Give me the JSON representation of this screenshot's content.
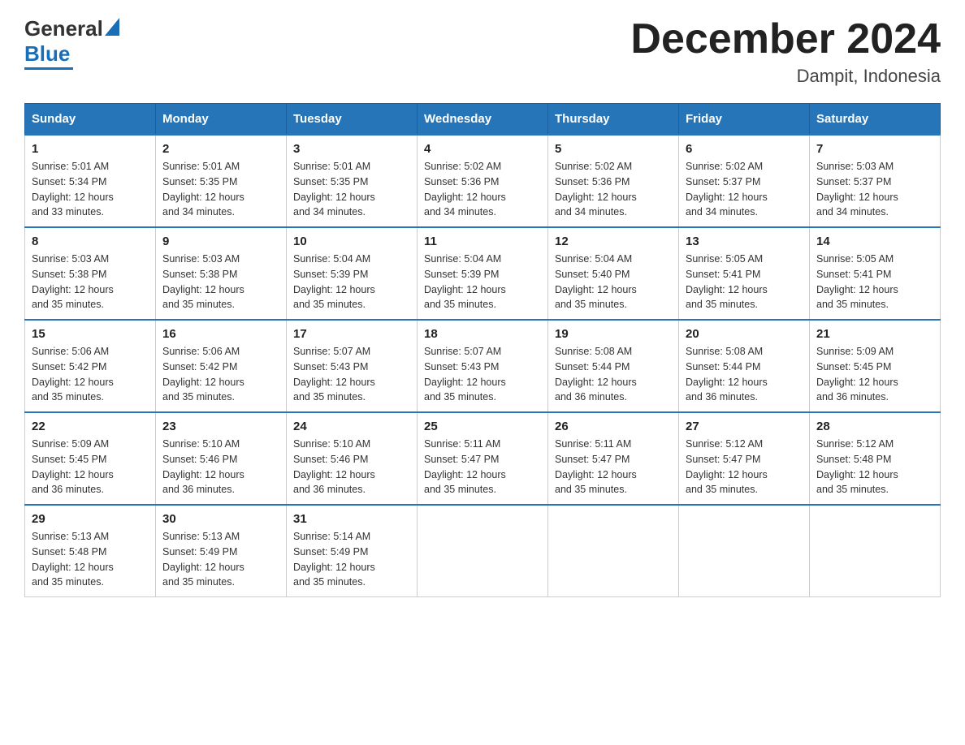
{
  "header": {
    "title": "December 2024",
    "subtitle": "Dampit, Indonesia",
    "logo_general": "General",
    "logo_blue": "Blue"
  },
  "days_of_week": [
    "Sunday",
    "Monday",
    "Tuesday",
    "Wednesday",
    "Thursday",
    "Friday",
    "Saturday"
  ],
  "weeks": [
    [
      {
        "day": "1",
        "sunrise": "5:01 AM",
        "sunset": "5:34 PM",
        "daylight": "12 hours and 33 minutes."
      },
      {
        "day": "2",
        "sunrise": "5:01 AM",
        "sunset": "5:35 PM",
        "daylight": "12 hours and 34 minutes."
      },
      {
        "day": "3",
        "sunrise": "5:01 AM",
        "sunset": "5:35 PM",
        "daylight": "12 hours and 34 minutes."
      },
      {
        "day": "4",
        "sunrise": "5:02 AM",
        "sunset": "5:36 PM",
        "daylight": "12 hours and 34 minutes."
      },
      {
        "day": "5",
        "sunrise": "5:02 AM",
        "sunset": "5:36 PM",
        "daylight": "12 hours and 34 minutes."
      },
      {
        "day": "6",
        "sunrise": "5:02 AM",
        "sunset": "5:37 PM",
        "daylight": "12 hours and 34 minutes."
      },
      {
        "day": "7",
        "sunrise": "5:03 AM",
        "sunset": "5:37 PM",
        "daylight": "12 hours and 34 minutes."
      }
    ],
    [
      {
        "day": "8",
        "sunrise": "5:03 AM",
        "sunset": "5:38 PM",
        "daylight": "12 hours and 35 minutes."
      },
      {
        "day": "9",
        "sunrise": "5:03 AM",
        "sunset": "5:38 PM",
        "daylight": "12 hours and 35 minutes."
      },
      {
        "day": "10",
        "sunrise": "5:04 AM",
        "sunset": "5:39 PM",
        "daylight": "12 hours and 35 minutes."
      },
      {
        "day": "11",
        "sunrise": "5:04 AM",
        "sunset": "5:39 PM",
        "daylight": "12 hours and 35 minutes."
      },
      {
        "day": "12",
        "sunrise": "5:04 AM",
        "sunset": "5:40 PM",
        "daylight": "12 hours and 35 minutes."
      },
      {
        "day": "13",
        "sunrise": "5:05 AM",
        "sunset": "5:41 PM",
        "daylight": "12 hours and 35 minutes."
      },
      {
        "day": "14",
        "sunrise": "5:05 AM",
        "sunset": "5:41 PM",
        "daylight": "12 hours and 35 minutes."
      }
    ],
    [
      {
        "day": "15",
        "sunrise": "5:06 AM",
        "sunset": "5:42 PM",
        "daylight": "12 hours and 35 minutes."
      },
      {
        "day": "16",
        "sunrise": "5:06 AM",
        "sunset": "5:42 PM",
        "daylight": "12 hours and 35 minutes."
      },
      {
        "day": "17",
        "sunrise": "5:07 AM",
        "sunset": "5:43 PM",
        "daylight": "12 hours and 35 minutes."
      },
      {
        "day": "18",
        "sunrise": "5:07 AM",
        "sunset": "5:43 PM",
        "daylight": "12 hours and 35 minutes."
      },
      {
        "day": "19",
        "sunrise": "5:08 AM",
        "sunset": "5:44 PM",
        "daylight": "12 hours and 36 minutes."
      },
      {
        "day": "20",
        "sunrise": "5:08 AM",
        "sunset": "5:44 PM",
        "daylight": "12 hours and 36 minutes."
      },
      {
        "day": "21",
        "sunrise": "5:09 AM",
        "sunset": "5:45 PM",
        "daylight": "12 hours and 36 minutes."
      }
    ],
    [
      {
        "day": "22",
        "sunrise": "5:09 AM",
        "sunset": "5:45 PM",
        "daylight": "12 hours and 36 minutes."
      },
      {
        "day": "23",
        "sunrise": "5:10 AM",
        "sunset": "5:46 PM",
        "daylight": "12 hours and 36 minutes."
      },
      {
        "day": "24",
        "sunrise": "5:10 AM",
        "sunset": "5:46 PM",
        "daylight": "12 hours and 36 minutes."
      },
      {
        "day": "25",
        "sunrise": "5:11 AM",
        "sunset": "5:47 PM",
        "daylight": "12 hours and 35 minutes."
      },
      {
        "day": "26",
        "sunrise": "5:11 AM",
        "sunset": "5:47 PM",
        "daylight": "12 hours and 35 minutes."
      },
      {
        "day": "27",
        "sunrise": "5:12 AM",
        "sunset": "5:47 PM",
        "daylight": "12 hours and 35 minutes."
      },
      {
        "day": "28",
        "sunrise": "5:12 AM",
        "sunset": "5:48 PM",
        "daylight": "12 hours and 35 minutes."
      }
    ],
    [
      {
        "day": "29",
        "sunrise": "5:13 AM",
        "sunset": "5:48 PM",
        "daylight": "12 hours and 35 minutes."
      },
      {
        "day": "30",
        "sunrise": "5:13 AM",
        "sunset": "5:49 PM",
        "daylight": "12 hours and 35 minutes."
      },
      {
        "day": "31",
        "sunrise": "5:14 AM",
        "sunset": "5:49 PM",
        "daylight": "12 hours and 35 minutes."
      },
      null,
      null,
      null,
      null
    ]
  ],
  "labels": {
    "sunrise": "Sunrise:",
    "sunset": "Sunset:",
    "daylight": "Daylight:"
  }
}
